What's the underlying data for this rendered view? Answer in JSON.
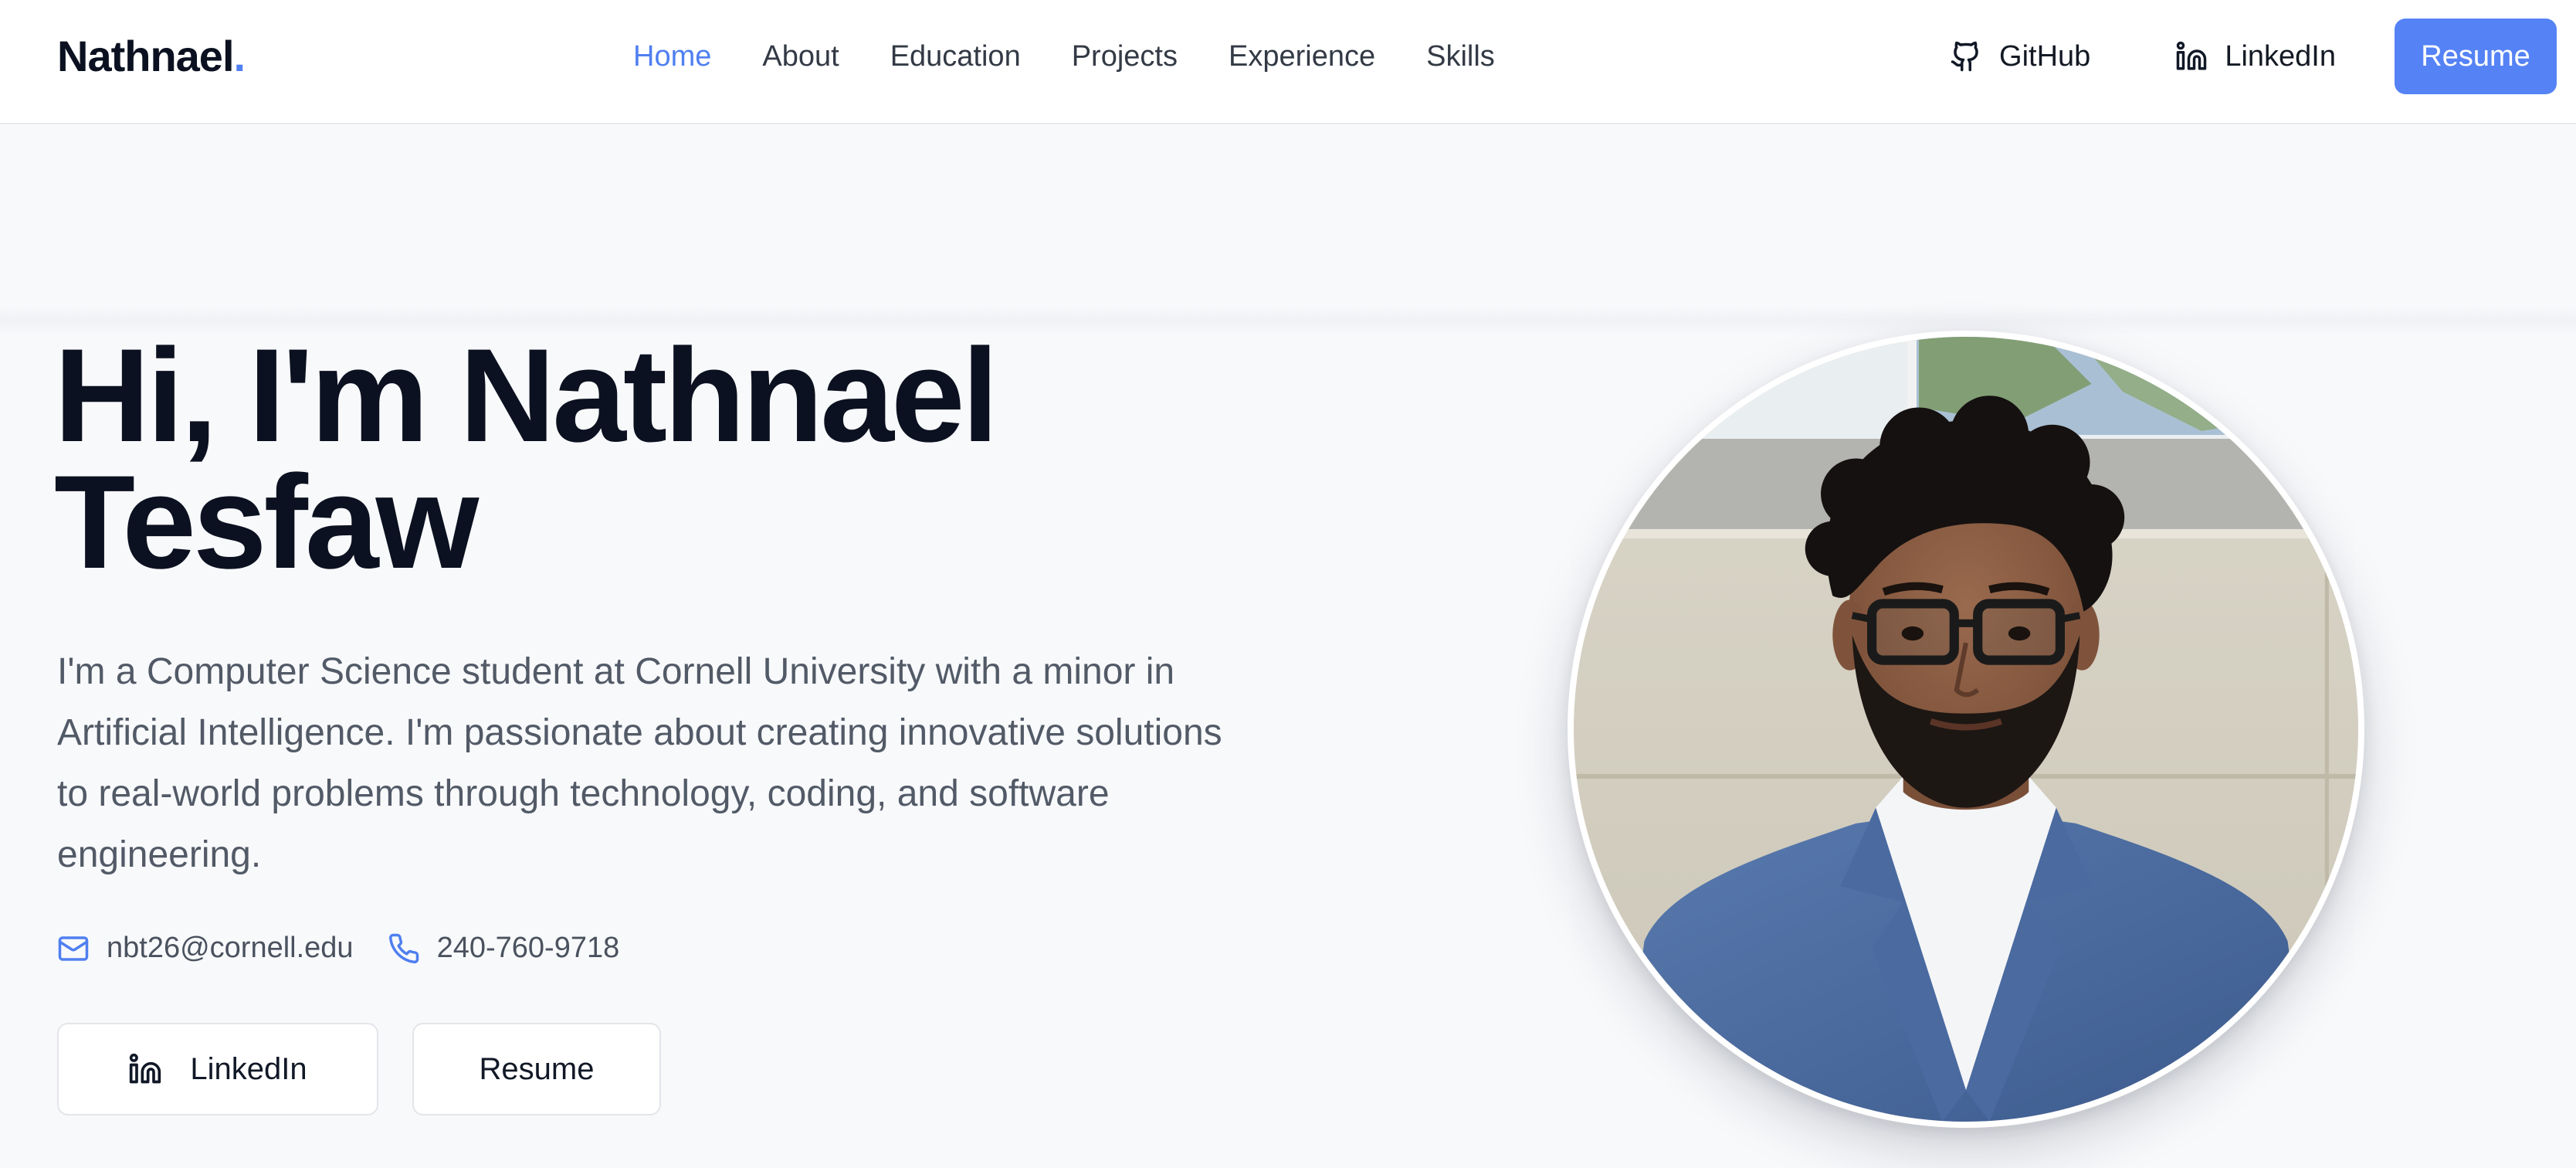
{
  "nav": {
    "logo_text": "Nathnael",
    "logo_dot": ".",
    "links": [
      "Home",
      "About",
      "Education",
      "Projects",
      "Experience",
      "Skills"
    ],
    "active_link": "Home",
    "github_label": "GitHub",
    "linkedin_label": "LinkedIn",
    "resume_label": "Resume"
  },
  "hero": {
    "title_line1": "Hi, I'm Nathnael",
    "title_line2": "Tesfaw",
    "description": "I'm a Computer Science student at Cornell University with a minor in Artificial Intelligence. I'm passionate about creating innovative solutions to real-world problems through technology, coding, and software engineering.",
    "email": "nbt26@cornell.edu",
    "phone": "240-760-9718",
    "linkedin_button": "LinkedIn",
    "resume_button": "Resume"
  },
  "icons": {
    "github": "github-icon",
    "linkedin": "linkedin-icon",
    "email": "mail-icon",
    "phone": "phone-icon"
  },
  "colors": {
    "accent": "#4f7ff0",
    "primary_button": "#5582f5",
    "heading": "#0b1120",
    "body_text": "#525a67",
    "background": "#f8f9fb"
  }
}
